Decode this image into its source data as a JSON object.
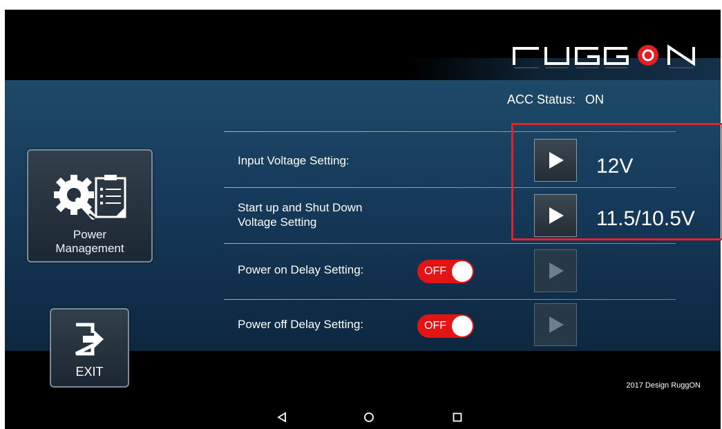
{
  "header": {
    "logo_text": "RUGGON"
  },
  "sidebar": {
    "power_management": {
      "line1": "Power",
      "line2": "Management"
    },
    "exit": {
      "label": "EXIT"
    }
  },
  "status": {
    "label": "ACC Status:",
    "value": "ON"
  },
  "settings": {
    "input_voltage": {
      "label": "Input Voltage Setting:",
      "value": "12V"
    },
    "startup_shutdown": {
      "label_line1": "Start up and Shut Down",
      "label_line2": "Voltage Setting",
      "value": "11.5/10.5V"
    },
    "power_on_delay": {
      "label": "Power on Delay Setting:",
      "toggle": "OFF"
    },
    "power_off_delay": {
      "label": "Power off Delay Setting:",
      "toggle": "OFF"
    }
  },
  "footer": {
    "copyright": "2017 Design RuggON"
  },
  "colors": {
    "toggle_off": "#e21414",
    "highlight": "#e0232d",
    "panel": "#16395a"
  }
}
